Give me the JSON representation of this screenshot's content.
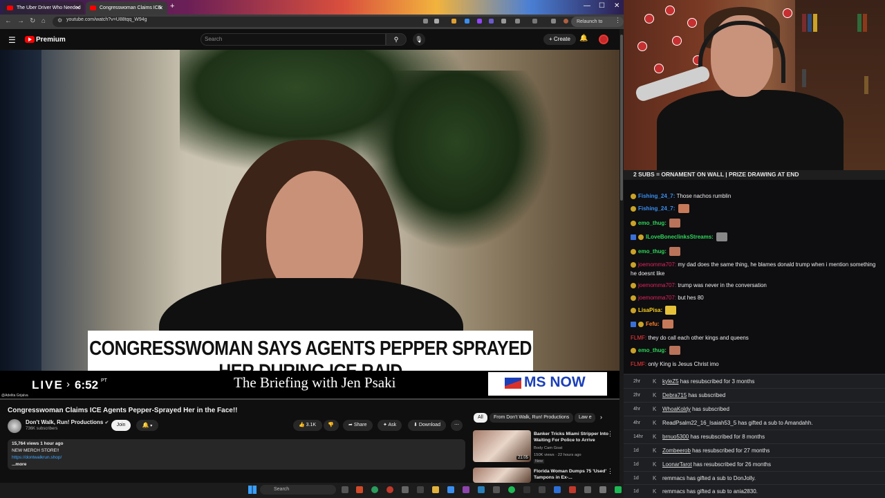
{
  "browser": {
    "tabs": [
      {
        "label": "The Uber Driver Who Needed"
      },
      {
        "label": "Congresswoman Claims ICE"
      }
    ],
    "url": "youtube.com/watch?v=U88tqq_W94g",
    "relaunch_label": "Relaunch to update"
  },
  "youtube": {
    "brand": "Premium",
    "search_placeholder": "Search",
    "create_label": "Create",
    "video": {
      "lower_third": "CONGRESSWOMAN SAYS AGENTS PEPPER SPRAYED HER DURING ICE RAID",
      "live": "LIVE",
      "time": "6:52",
      "time_suffix": "PT",
      "show": "The Briefing with Jen Psaki",
      "network": "MS NOW",
      "credit": "@Adelita Grijalva",
      "progress": 0.0
    },
    "title": "Congresswoman Claims ICE Agents Pepper-Sprayed Her in the Face!!",
    "channel": {
      "name": "Don't Walk, Run! Productions",
      "subscribers": "736K subscribers",
      "join": "Join"
    },
    "actions": {
      "likes": "3.1K",
      "share": "Share",
      "ask": "Ask",
      "download": "Download"
    },
    "description": {
      "stats": "15,764 views  1 hour ago",
      "line1": "NEW MERCH STORE!!",
      "link": "https://dontwalkrun.shop/",
      "more": "...more"
    },
    "chips": [
      "All",
      "From Don't Walk, Run! Productions",
      "Law e"
    ],
    "recommendations": [
      {
        "title": "Banker Tricks Miami Stripper Into Waiting For Police to Arrive",
        "channel": "Body Cam Goat",
        "meta": "150K views · 22 hours ago",
        "badge": "New",
        "duration": "21:05"
      },
      {
        "title": "Florida Woman Dumps 75 'Used' Tampons in Ex-...",
        "channel": "",
        "meta": "",
        "badge": "",
        "duration": ""
      }
    ],
    "taskbar_search": "Search"
  },
  "stream": {
    "banner": "2 SUBS = ORNAMENT ON WALL | PRIZE DRAWING AT END",
    "chat": [
      {
        "user": "Fishing_24_7",
        "sep": ": ",
        "text": "Those nachos rumblin",
        "color": "blue"
      },
      {
        "user": "Fishing_24_7",
        "sep": ": ",
        "text": "",
        "color": "blue"
      },
      {
        "user": "emo_thug",
        "sep": ": ",
        "text": "",
        "color": "green"
      },
      {
        "user": "ILoveBoneclinksStreams",
        "sep": ": ",
        "text": "",
        "color": "green"
      },
      {
        "user": "emo_thug",
        "sep": ": ",
        "text": "",
        "color": "green"
      },
      {
        "user": "joemomma707",
        "sep": ": ",
        "text": "my dad does the same thing, he blames donald trump when i mention something he doesnt like",
        "color": "pink"
      },
      {
        "user": "joemomma707",
        "sep": ": ",
        "text": "trump was never in the conversation",
        "color": "pink"
      },
      {
        "user": "joemomma707",
        "sep": ": ",
        "text": "but hes 80",
        "color": "pink"
      },
      {
        "user": "LisaPisa",
        "sep": ": ",
        "text": "",
        "color": "yellow"
      },
      {
        "user": "Fefu",
        "sep": ": ",
        "text": "",
        "color": "orange"
      },
      {
        "user": "FLMF",
        "sep": ": ",
        "text": "they do call each other kings and queens",
        "color": "red"
      },
      {
        "user": "emo_thug",
        "sep": ": ",
        "text": "",
        "color": "green"
      },
      {
        "user": "FLMF",
        "sep": ": ",
        "text": "only King is Jesus Christ imo",
        "color": "red"
      }
    ],
    "events": [
      {
        "time": "2hr",
        "name": "kyleZ5",
        "text": " has resubscribed for 3 months"
      },
      {
        "time": "2hr",
        "name": "Debra715",
        "text": " has subscribed"
      },
      {
        "time": "4hr",
        "name": "WhoaKoldy",
        "text": " has subscribed"
      },
      {
        "time": "4hr",
        "name": "ReadPsalm22_16_Isaiah53_5",
        "text": " has gifted a sub to Amandahh."
      },
      {
        "time": "14hr",
        "name": "brnuo5300",
        "text": " has resubscribed for 8 months"
      },
      {
        "time": "1d",
        "name": "Zombeerob",
        "text": " has resubscribed for 27 months"
      },
      {
        "time": "1d",
        "name": "LoonarTarot",
        "text": " has resubscribed for 26 months"
      },
      {
        "time": "1d",
        "name": "remmacs",
        "text": " has gifted a sub to DonJolly."
      },
      {
        "time": "1d",
        "name": "remmacs",
        "text": " has gifted a sub to ania2830."
      }
    ]
  }
}
